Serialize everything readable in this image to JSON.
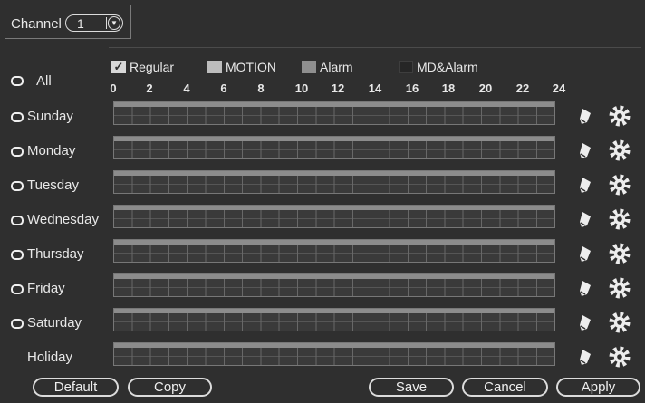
{
  "channel": {
    "label": "Channel",
    "value": "1"
  },
  "legend": [
    {
      "key": "regular",
      "label": "Regular",
      "checked": true,
      "color": "#d8d8d8"
    },
    {
      "key": "motion",
      "label": "MOTION",
      "color": "#bdbdbd"
    },
    {
      "key": "alarm",
      "label": "Alarm",
      "color": "#8f8f8f"
    },
    {
      "key": "md_alarm",
      "label": "MD&Alarm",
      "color": "#262626"
    }
  ],
  "all_label": "All",
  "hours": [
    "0",
    "2",
    "4",
    "6",
    "8",
    "10",
    "12",
    "14",
    "16",
    "18",
    "20",
    "22",
    "24"
  ],
  "days": [
    {
      "label": "Sunday",
      "radio": true
    },
    {
      "label": "Monday",
      "radio": true
    },
    {
      "label": "Tuesday",
      "radio": true
    },
    {
      "label": "Wednesday",
      "radio": true
    },
    {
      "label": "Thursday",
      "radio": true
    },
    {
      "label": "Friday",
      "radio": true
    },
    {
      "label": "Saturday",
      "radio": true
    },
    {
      "label": "Holiday",
      "radio": false
    }
  ],
  "row_icons": {
    "edit": "pencil-icon",
    "settings": "gear-icon"
  },
  "buttons": {
    "default": "Default",
    "copy": "Copy",
    "save": "Save",
    "cancel": "Cancel",
    "apply": "Apply"
  }
}
